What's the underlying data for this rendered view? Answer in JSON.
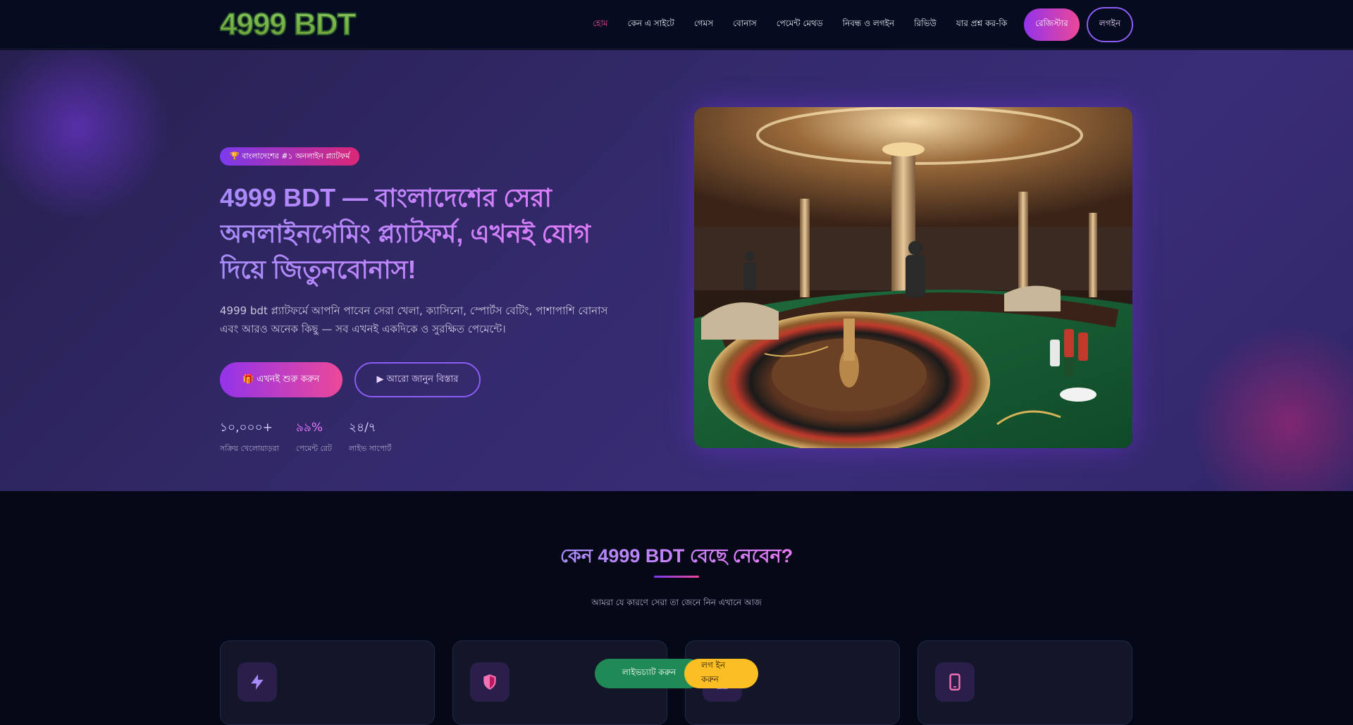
{
  "header": {
    "logo": "4999 BDT",
    "nav": [
      {
        "label": "হোম",
        "active": true
      },
      {
        "label": "কেন এ সাইটে",
        "active": false
      },
      {
        "label": "গেমস",
        "active": false
      },
      {
        "label": "বোনাস",
        "active": false
      },
      {
        "label": "পেমেন্ট মেথড",
        "active": false
      },
      {
        "label": "নিবন্ধ ও লগইন",
        "active": false
      },
      {
        "label": "রিভিউ",
        "active": false
      },
      {
        "label": "যার প্রশ্ন কর-কি",
        "active": false
      }
    ],
    "signup_label": "রেজিস্টার",
    "login_label": "লগইন"
  },
  "hero": {
    "badge": "🏆 বাংলাদেশের #১ অনলাইন প্ল্যাটফর্ম",
    "title": "4999 BDT — বাংলাদেশের সেরা অনলাইনগেমিং প্ল্যাটফর্ম, এখনই যোগ দিয়ে জিতুনবোনাস!",
    "description": "4999 bdt প্ল্যাটফর্মে আপনি পাবেন সেরা খেলা, ক্যাসিনো, স্পোর্টস বেটিং, পাশাপাশি বোনাস এবং আরও অনেক কিছু — সব এখনই একদিকে ও সুরক্ষিত পেমেন্টে।",
    "primary_cta": "🎁 এখনই শুরু করুন",
    "secondary_cta": "▶ আরো জানুন বিস্তার",
    "stats": [
      {
        "value": "১০,০০০+",
        "label": "সক্রিয় খেলোয়াড়রা",
        "pink": false
      },
      {
        "value": "৯৯%",
        "label": "পেমেন্ট রেট",
        "pink": true
      },
      {
        "value": "২৪/৭",
        "label": "লাইভ সাপোর্ট",
        "pink": false
      }
    ],
    "image_alt": "casino roulette table"
  },
  "section": {
    "title": "কেন 4999 BDT বেছে নেবেন?",
    "subtitle": "আমরা যে কারণে সেরা তা জেনে নিন এখানে আজ",
    "cards": [
      {
        "icon": "lightning-icon"
      },
      {
        "icon": "shield-icon"
      },
      {
        "icon": "gift-icon"
      },
      {
        "icon": "mobile-icon"
      }
    ]
  },
  "floating": {
    "green_label": "লাইভচ্যাট করুন",
    "yellow_label": "লগ ইন করুন"
  },
  "colors": {
    "accent_purple": "#9333ea",
    "accent_pink": "#ec4899",
    "background": "#050816"
  }
}
